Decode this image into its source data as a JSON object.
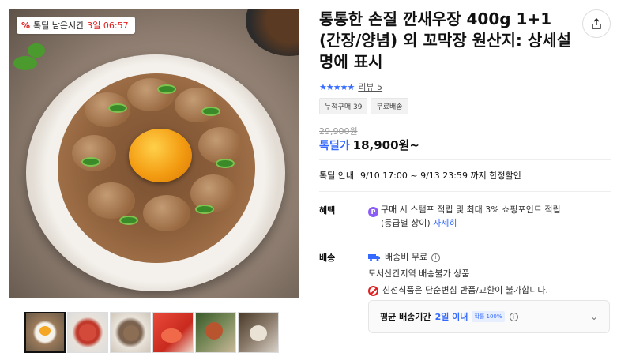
{
  "gallery": {
    "badge": {
      "icon": "%",
      "label": "톡딜 남은시간",
      "time": "3일 06:57"
    },
    "thumbnails": [
      {
        "name": "thumb-1",
        "active": true
      },
      {
        "name": "thumb-2",
        "active": false
      },
      {
        "name": "thumb-3",
        "active": false
      },
      {
        "name": "thumb-4",
        "active": false
      },
      {
        "name": "thumb-5",
        "active": false
      },
      {
        "name": "thumb-6",
        "active": false
      }
    ]
  },
  "product": {
    "title": "통통한 손질 깐새우장 400g 1+1 (간장/양념) 외 꼬막장 원산지: 상세설명에 표시",
    "rating": {
      "stars": "★★★★★",
      "review_label": "리뷰 5"
    },
    "tags": [
      "누적구매 39",
      "무료배송"
    ],
    "original_price": "29,900원",
    "sale_label": "톡딜가",
    "sale_price": "18,900원~",
    "deal": {
      "label": "톡딜 안내",
      "period": "9/10 17:00 ~ 9/13 23:59 까지 한정할인"
    }
  },
  "benefit": {
    "label": "혜택",
    "coin": "P",
    "text": "구매 시 스탬프 적립 및 최대 3% 쇼핑포인트 적립",
    "text2": "(등급별 상이)",
    "link": "자세히"
  },
  "shipping": {
    "label": "배송",
    "fee": "배송비 무료",
    "info_icon": "i",
    "note": "도서산간지역 배송불가 상품",
    "warning": "신선식품은 단순변심 반품/교환이 불가합니다.",
    "avg": {
      "label": "평균 배송기간",
      "value": "2일 이내",
      "badge": "확률 100%"
    }
  },
  "colors": {
    "accent": "#346aff",
    "alert": "#e02020"
  }
}
